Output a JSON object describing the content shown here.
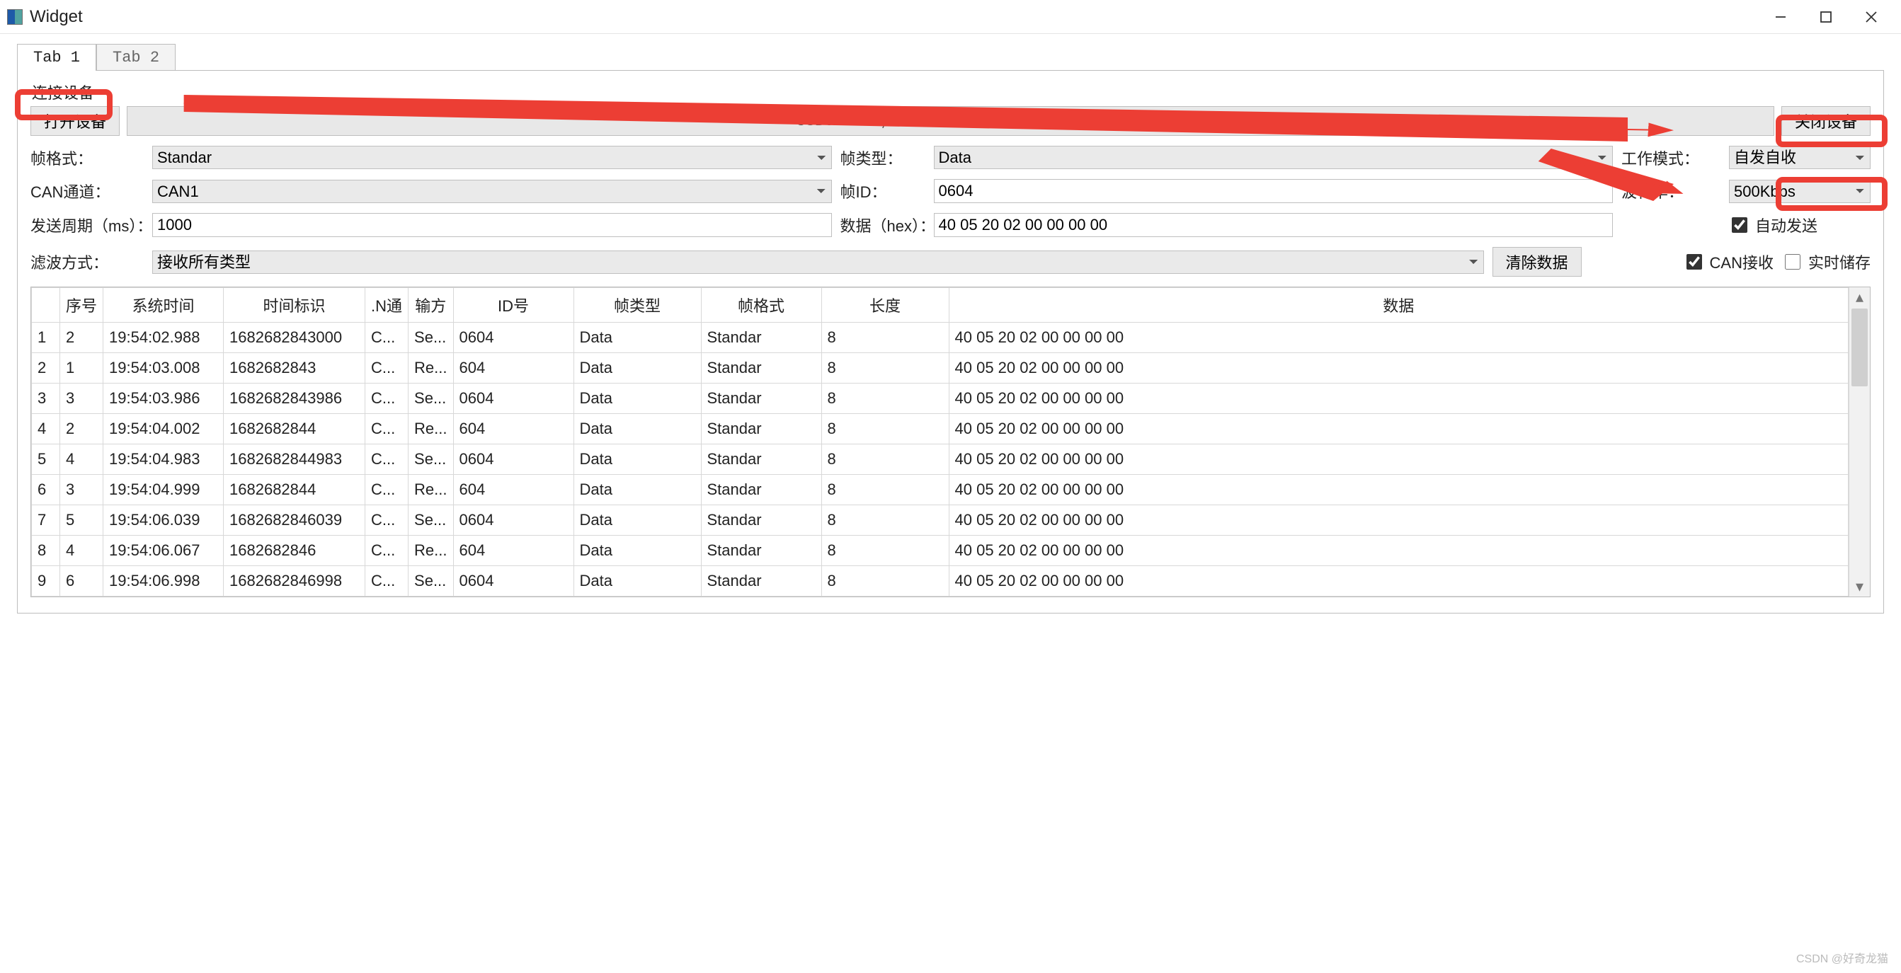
{
  "window": {
    "title": "Widget"
  },
  "tabs": [
    {
      "label": "Tab 1",
      "active": true
    },
    {
      "label": "Tab 2",
      "active": false
    }
  ],
  "group": {
    "legend": "连接设备"
  },
  "devrow": {
    "open_label": "打开设备",
    "close_label": "关闭设备",
    "device_text": "USBCAN-2A, USBCAN-2C, CANalyst-II"
  },
  "form": {
    "frame_format": {
      "label": "帧格式：",
      "value": "Standar"
    },
    "frame_type": {
      "label": "帧类型：",
      "value": "Data"
    },
    "work_mode": {
      "label": "工作模式：",
      "value": "自发自收"
    },
    "can_channel": {
      "label": "CAN通道：",
      "value": "CAN1"
    },
    "frame_id": {
      "label": "帧ID：",
      "value": "0604"
    },
    "baud_rate": {
      "label": "波特率：",
      "value": "500Kbps"
    },
    "send_period": {
      "label": "发送周期（ms）：",
      "value": "1000"
    },
    "data_hex": {
      "label": "数据（hex）：",
      "value": "40 05 20 02 00 00 00 00"
    },
    "auto_send": {
      "label": "自动发送",
      "checked": true
    },
    "filter_mode": {
      "label": "滤波方式：",
      "value": "接收所有类型"
    },
    "clear_btn": "清除数据",
    "can_recv": {
      "label": "CAN接收",
      "checked": true
    },
    "realtime_save": {
      "label": "实时储存",
      "checked": false
    }
  },
  "table": {
    "headers": {
      "idx": "",
      "seq": "序号",
      "time": "系统时间",
      "stamp": "时间标识",
      "ch": ".N通",
      "dir": "输方",
      "id": "ID号",
      "ftype": "帧类型",
      "ffmt": "帧格式",
      "len": "长度",
      "data": "数据"
    },
    "rows": [
      {
        "idx": "1",
        "seq": "2",
        "time": "19:54:02.988",
        "stamp": "1682682843000",
        "ch": "C...",
        "dir": "Se...",
        "id": "0604",
        "ftype": "Data",
        "ffmt": "Standar",
        "len": "8",
        "data": "40 05 20 02 00 00 00 00"
      },
      {
        "idx": "2",
        "seq": "1",
        "time": "19:54:03.008",
        "stamp": "1682682843",
        "ch": "C...",
        "dir": "Re...",
        "id": "604",
        "ftype": "Data",
        "ffmt": "Standar",
        "len": "8",
        "data": "40 05 20 02 00 00 00 00"
      },
      {
        "idx": "3",
        "seq": "3",
        "time": "19:54:03.986",
        "stamp": "1682682843986",
        "ch": "C...",
        "dir": "Se...",
        "id": "0604",
        "ftype": "Data",
        "ffmt": "Standar",
        "len": "8",
        "data": "40 05 20 02 00 00 00 00"
      },
      {
        "idx": "4",
        "seq": "2",
        "time": "19:54:04.002",
        "stamp": "1682682844",
        "ch": "C...",
        "dir": "Re...",
        "id": "604",
        "ftype": "Data",
        "ffmt": "Standar",
        "len": "8",
        "data": "40 05 20 02 00 00 00 00"
      },
      {
        "idx": "5",
        "seq": "4",
        "time": "19:54:04.983",
        "stamp": "1682682844983",
        "ch": "C...",
        "dir": "Se...",
        "id": "0604",
        "ftype": "Data",
        "ffmt": "Standar",
        "len": "8",
        "data": "40 05 20 02 00 00 00 00"
      },
      {
        "idx": "6",
        "seq": "3",
        "time": "19:54:04.999",
        "stamp": "1682682844",
        "ch": "C...",
        "dir": "Re...",
        "id": "604",
        "ftype": "Data",
        "ffmt": "Standar",
        "len": "8",
        "data": "40 05 20 02 00 00 00 00"
      },
      {
        "idx": "7",
        "seq": "5",
        "time": "19:54:06.039",
        "stamp": "1682682846039",
        "ch": "C...",
        "dir": "Se...",
        "id": "0604",
        "ftype": "Data",
        "ffmt": "Standar",
        "len": "8",
        "data": "40 05 20 02 00 00 00 00"
      },
      {
        "idx": "8",
        "seq": "4",
        "time": "19:54:06.067",
        "stamp": "1682682846",
        "ch": "C...",
        "dir": "Re...",
        "id": "604",
        "ftype": "Data",
        "ffmt": "Standar",
        "len": "8",
        "data": "40 05 20 02 00 00 00 00"
      },
      {
        "idx": "9",
        "seq": "6",
        "time": "19:54:06.998",
        "stamp": "1682682846998",
        "ch": "C...",
        "dir": "Se...",
        "id": "0604",
        "ftype": "Data",
        "ffmt": "Standar",
        "len": "8",
        "data": "40 05 20 02 00 00 00 00"
      }
    ]
  },
  "watermark": "CSDN @好奇龙猫"
}
